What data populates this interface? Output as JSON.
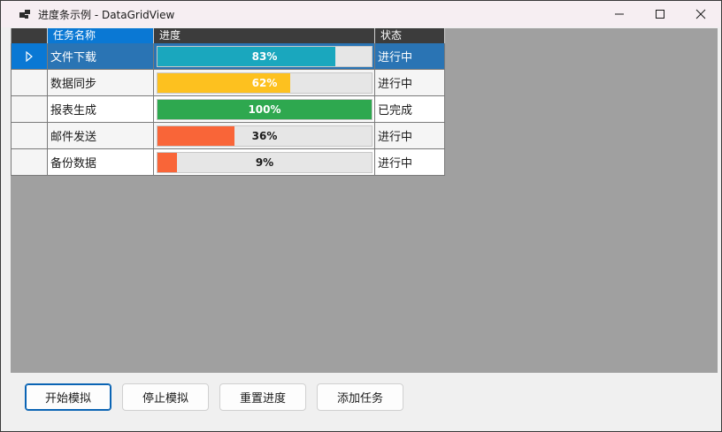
{
  "window": {
    "title": "进度条示例 - DataGridView"
  },
  "icons": {
    "app": "app-window-icon",
    "minimize": "minimize-icon",
    "maximize": "maximize-icon",
    "close": "close-icon",
    "current_row": "current-row-triangle-icon"
  },
  "grid": {
    "columns": [
      "任务名称",
      "进度",
      "状态"
    ],
    "rows": [
      {
        "name": "文件下载",
        "progress": 83,
        "progress_label": "83%",
        "status": "进行中",
        "bar_color": "#1aa7be",
        "label_color": "#ffffff"
      },
      {
        "name": "数据同步",
        "progress": 62,
        "progress_label": "62%",
        "status": "进行中",
        "bar_color": "#fdc11f",
        "label_color": "#ffffff"
      },
      {
        "name": "报表生成",
        "progress": 100,
        "progress_label": "100%",
        "status": "已完成",
        "bar_color": "#2ea84f",
        "label_color": "#ffffff"
      },
      {
        "name": "邮件发送",
        "progress": 36,
        "progress_label": "36%",
        "status": "进行中",
        "bar_color": "#f96538",
        "label_color": "#1a1a1a"
      },
      {
        "name": "备份数据",
        "progress": 9,
        "progress_label": "9%",
        "status": "进行中",
        "bar_color": "#f96538",
        "label_color": "#1a1a1a"
      }
    ],
    "selected_row": 0
  },
  "buttons": {
    "start": "开始模拟",
    "stop": "停止模拟",
    "reset": "重置进度",
    "add": "添加任务"
  }
}
